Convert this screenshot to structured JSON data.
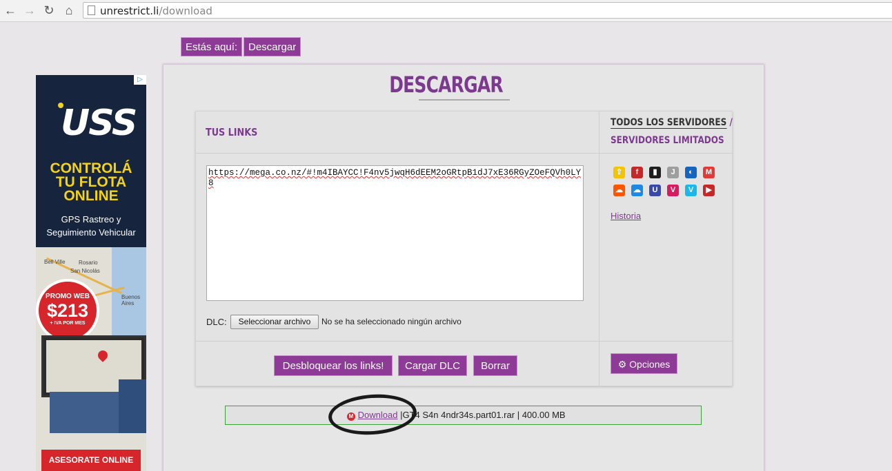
{
  "browser": {
    "url_host": "unrestrict.li",
    "url_path": "/download"
  },
  "breadcrumb": {
    "prefix": "Estás aquí:",
    "current": "Descargar"
  },
  "ad": {
    "choices_label": "▷",
    "logo": "USS",
    "headline_lines": [
      "CONTROLÁ",
      "TU FLOTA",
      "ONLINE"
    ],
    "subline_lines": [
      "GPS Rastreo y",
      "Seguimiento Vehicular"
    ],
    "map_towns": [
      "Bell Ville",
      "Rosario",
      "San Nicolás",
      "Buenos Aires"
    ],
    "promo_label": "PROMO WEB",
    "promo_price": "$213",
    "promo_note": "+ IVA POR MES",
    "cta": "ASESORATE ONLINE"
  },
  "page": {
    "title": "DESCARGAR"
  },
  "links_section": {
    "heading": "TUS LINKS",
    "textarea_value": "https://mega.co.nz/#!m4IBAYCC!F4nv5jwqH6dEEM2oGRtpB1dJ7xE36RGyZOeFQVh0LY8",
    "dlc_label": "DLC:",
    "file_button": "Seleccionar archivo",
    "file_status": "No se ha seleccionado ningún archivo"
  },
  "servers": {
    "all_label": "TODOS LOS SERVIDORES",
    "separator": "/",
    "limited_label": "SERVIDORES LIMITADOS",
    "icons": [
      {
        "name": "uploaded-icon",
        "glyph": "⇧",
        "color": "#f5c400"
      },
      {
        "name": "filefactory-icon",
        "glyph": "f",
        "color": "#c62828"
      },
      {
        "name": "audio-server-icon",
        "glyph": "▮",
        "color": "#1e1e1e"
      },
      {
        "name": "jumbo-icon",
        "glyph": "J",
        "color": "#9e9e9e"
      },
      {
        "name": "depositfiles-icon",
        "glyph": "◐",
        "color": "#1565c0"
      },
      {
        "name": "mega-server-icon",
        "glyph": "M",
        "color": "#e53935"
      },
      {
        "name": "soundcloud-icon",
        "glyph": "☁",
        "color": "#ff5500"
      },
      {
        "name": "cloud-server-icon",
        "glyph": "☁",
        "color": "#1e88e5"
      },
      {
        "name": "uptobox-icon",
        "glyph": "U",
        "color": "#3949ab"
      },
      {
        "name": "vimeo-red-icon",
        "glyph": "V",
        "color": "#d81b60"
      },
      {
        "name": "vimeo-icon",
        "glyph": "V",
        "color": "#1ab7ea"
      },
      {
        "name": "youtube-icon",
        "glyph": "▶",
        "color": "#c62828"
      }
    ],
    "history_link": "Historia"
  },
  "actions": {
    "unlock": "Desbloquear los links!",
    "load_dlc": "Cargar DLC",
    "clear": "Borrar",
    "options": "Opciones"
  },
  "result": {
    "link_text": "Download",
    "separator": "|",
    "filename": "GT4 S4n 4ndr34s.part01.rar",
    "size": "400.00 MB",
    "status_color": "#3aa33a"
  }
}
